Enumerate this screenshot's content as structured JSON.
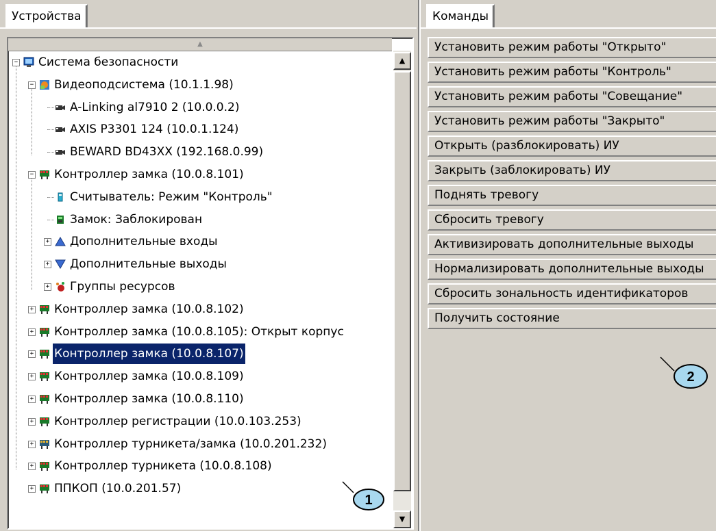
{
  "left_panel": {
    "tab_label": "Устройства",
    "tree": [
      {
        "label": "Система безопасности",
        "icon": "system-icon",
        "expander": "minus"
      },
      {
        "label": "Видеоподсистема (10.1.1.98)",
        "icon": "video-subsystem-icon",
        "expander": "minus"
      },
      {
        "label": "A-Linking al7910 2 (10.0.0.2)",
        "icon": "camera-icon",
        "expander": ""
      },
      {
        "label": "AXIS P3301 124 (10.0.1.124)",
        "icon": "camera-icon",
        "expander": ""
      },
      {
        "label": "BEWARD BD43XX (192.168.0.99)",
        "icon": "camera-icon",
        "expander": ""
      },
      {
        "label": "Контроллер замка (10.0.8.101)",
        "icon": "controller-icon",
        "expander": "minus"
      },
      {
        "label": "Считыватель: Режим \"Контроль\"",
        "icon": "reader-icon",
        "expander": ""
      },
      {
        "label": "Замок: Заблокирован",
        "icon": "lock-icon",
        "expander": ""
      },
      {
        "label": "Дополнительные входы",
        "icon": "inputs-icon",
        "expander": "plus"
      },
      {
        "label": "Дополнительные выходы",
        "icon": "outputs-icon",
        "expander": "plus"
      },
      {
        "label": "Группы ресурсов",
        "icon": "resource-groups-icon",
        "expander": "plus"
      },
      {
        "label": "Контроллер замка (10.0.8.102)",
        "icon": "controller-icon",
        "expander": "plus"
      },
      {
        "label": "Контроллер замка (10.0.8.105): Открыт корпус",
        "icon": "controller-icon",
        "expander": "plus"
      },
      {
        "label": "Контроллер замка (10.0.8.107)",
        "icon": "controller-icon",
        "expander": "plus",
        "selected": true
      },
      {
        "label": "Контроллер замка (10.0.8.109)",
        "icon": "controller-icon",
        "expander": "plus"
      },
      {
        "label": "Контроллер замка (10.0.8.110)",
        "icon": "controller-icon",
        "expander": "plus"
      },
      {
        "label": "Контроллер регистрации (10.0.103.253)",
        "icon": "controller-icon",
        "expander": "plus"
      },
      {
        "label": "Контроллер турникета/замка (10.0.201.232)",
        "icon": "turnstile-controller-icon",
        "expander": "plus"
      },
      {
        "label": "Контроллер турникета (10.0.8.108)",
        "icon": "controller-icon",
        "expander": "plus"
      },
      {
        "label": "ППКОП (10.0.201.57)",
        "icon": "controller-icon",
        "expander": "plus"
      }
    ],
    "callout_label": "1"
  },
  "right_panel": {
    "tab_label": "Команды",
    "commands": [
      "Установить режим работы \"Открыто\"",
      "Установить режим работы \"Контроль\"",
      "Установить режим работы \"Совещание\"",
      "Установить режим работы \"Закрыто\"",
      "Открыть (разблокировать) ИУ",
      "Закрыть (заблокировать) ИУ",
      "Поднять тревогу",
      "Сбросить тревогу",
      "Активизировать дополнительные выходы",
      "Нормализировать дополнительные выходы",
      "Сбросить зональность идентификаторов",
      "Получить состояние"
    ],
    "callout_label": "2"
  },
  "colors": {
    "window_bg": "#d4d0c8",
    "selection_bg": "#0a246a",
    "callout_fill": "#a8d8ef"
  }
}
